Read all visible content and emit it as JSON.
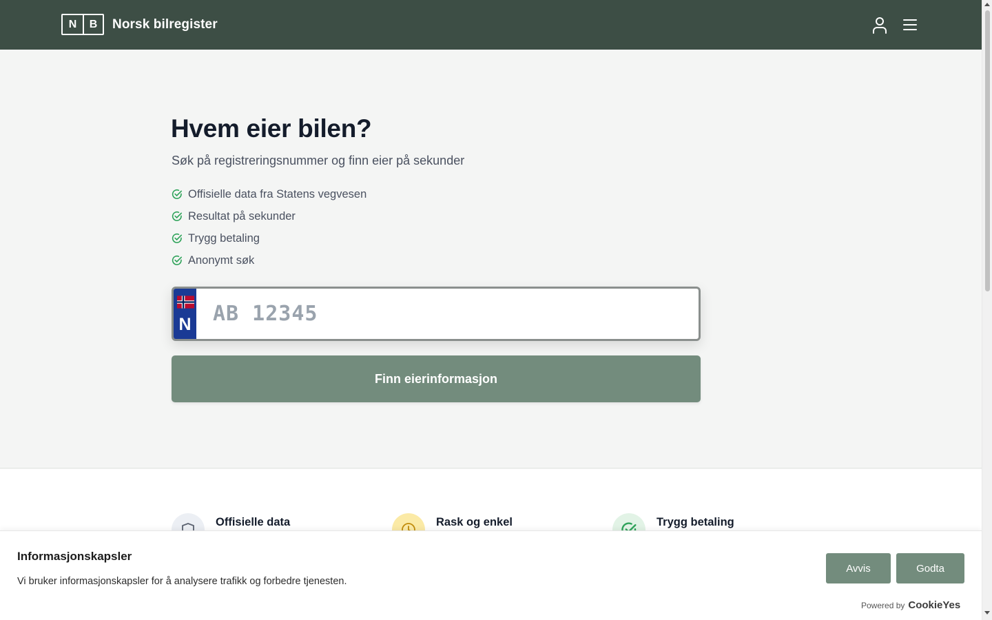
{
  "header": {
    "logo_letters": [
      "N",
      "B"
    ],
    "title": "Norsk bilregister",
    "icons": [
      "user-icon",
      "menu-icon"
    ],
    "background": "#3d4e45"
  },
  "hero": {
    "title": "Hvem eier bilen?",
    "subtitle": "Søk på registreringsnummer og finn eier på sekunder",
    "features": [
      "Offisielle data fra Statens vegvesen",
      "Resultat på sekunder",
      "Trygg betaling",
      "Anonymt søk"
    ],
    "plate": {
      "country_code": "N",
      "placeholder": "AB 12345",
      "value": ""
    },
    "search_button": "Finn eierinformasjon"
  },
  "features_section": [
    {
      "title": "Offisielle data",
      "icon": "shield-icon"
    },
    {
      "title": "Rask og enkel",
      "icon": "clock-icon"
    },
    {
      "title": "Trygg betaling",
      "icon": "check-circle-icon"
    }
  ],
  "cookie_banner": {
    "title": "Informasjonskapsler",
    "text": "Vi bruker informasjonskapsler for å analysere trafikk og forbedre tjenesten.",
    "reject_label": "Avvis",
    "accept_label": "Godta",
    "powered_by": "Powered by",
    "brand": "CookieYes"
  },
  "colors": {
    "accent": "#738c7d",
    "check_green": "#2fa35a",
    "plate_blue": "#1a3a95"
  }
}
